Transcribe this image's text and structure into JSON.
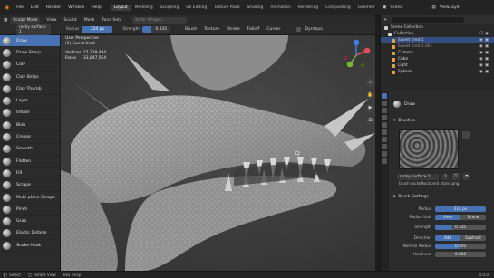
{
  "menubar": {
    "menus": [
      "File",
      "Edit",
      "Render",
      "Window",
      "Help"
    ],
    "tabs": [
      "Layout",
      "Modeling",
      "Sculpting",
      "UV Editing",
      "Texture Paint",
      "Shading",
      "Animation",
      "Rendering",
      "Compositing",
      "Geometr"
    ],
    "active_tab": "Layout",
    "scene_label": "Scene",
    "viewlayer_label": "ViewLayer"
  },
  "toolbar": {
    "mode": "Sculpt Mode",
    "menus": [
      "View",
      "Sculpt",
      "Mask",
      "Face Sets"
    ],
    "search_placeholder": "Enter Widget..."
  },
  "tool_header": {
    "brush_name": "rocky surface 1",
    "radius_label": "Radius",
    "radius_value": "224 px",
    "strength_label": "Strength",
    "strength_value": "0.335",
    "menus": [
      "Brush",
      "Texture",
      "Stroke",
      "Falloff",
      "Cursor"
    ],
    "dyntopo_label": "Dyntopo"
  },
  "stats": {
    "view": "User Perspective",
    "object": "(1) Sweet tired",
    "verts_label": "Vertices",
    "verts_value": "27,239,494",
    "faces_label": "Faces",
    "faces_value": "33,847,564"
  },
  "brushes": [
    "Draw",
    "Draw Sharp",
    "Clay",
    "Clay Strips",
    "Clay Thumb",
    "Layer",
    "Inflate",
    "Blob",
    "Crease",
    "Smooth",
    "Flatten",
    "Fill",
    "Scrape",
    "Multi-plane Scrape",
    "Pinch",
    "Grab",
    "Elastic Deform",
    "Snake Hook"
  ],
  "selected_brush": "Draw",
  "outliner": {
    "title": "Scene Collection",
    "items": [
      {
        "name": "Collection",
        "selected": false
      },
      {
        "name": "Sweet tired 1",
        "selected": true
      },
      {
        "name": "Sweet tired 1.001",
        "selected": false
      },
      {
        "name": "Camera",
        "selected": false
      },
      {
        "name": "Cube",
        "selected": false
      },
      {
        "name": "Light",
        "selected": false
      },
      {
        "name": "Sphere",
        "selected": false
      }
    ]
  },
  "properties": {
    "tool_title": "Draw",
    "brushes_section": "Brushes",
    "brush_name": "rocky surface 1",
    "brush_count": "2",
    "texture_name": "brush rockeNock and stone.png",
    "settings_section": "Brush Settings",
    "rows": [
      {
        "label": "Radius",
        "value": "224 px"
      },
      {
        "label": "Radius Unit",
        "value": "View",
        "alt": "Scene"
      },
      {
        "label": "Strength",
        "value": "0.335"
      },
      {
        "label": "Direction",
        "value": "Add",
        "alt": "Subtract"
      },
      {
        "label": "Normal Radius",
        "value": "0.500"
      },
      {
        "label": "Hardness",
        "value": "0.000"
      }
    ]
  },
  "statusbar": {
    "left": "Select",
    "middle": "Rotate View",
    "right_hint": "Box Snap",
    "version": "4.0.0"
  },
  "colors": {
    "accent": "#4772b3",
    "active_tab": "#3d3d3d",
    "viewport": "#3c3c3c"
  }
}
